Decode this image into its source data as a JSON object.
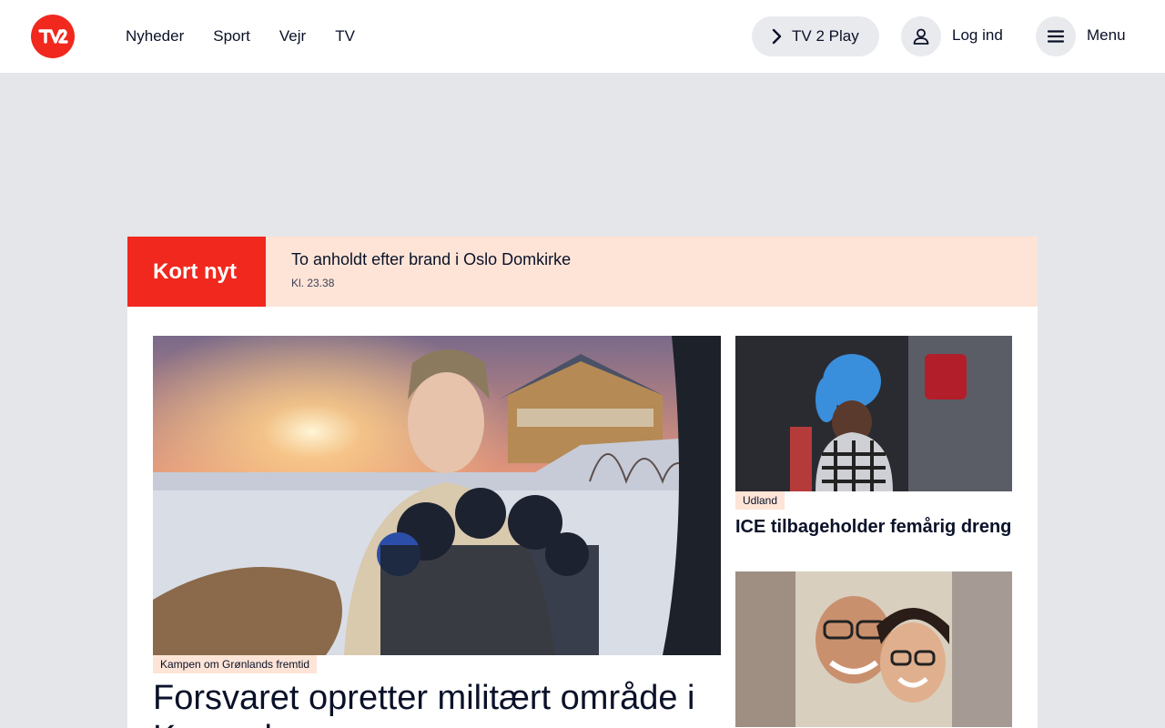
{
  "header": {
    "logo_icon": "tv2-logo",
    "nav": [
      "Nyheder",
      "Sport",
      "Vejr",
      "TV"
    ],
    "play_label": "TV 2 Play",
    "login_label": "Log ind",
    "menu_label": "Menu"
  },
  "kort_nyt": {
    "label": "Kort nyt",
    "headline": "To anholdt efter brand i Oslo Domkirke",
    "time": "Kl. 23.38"
  },
  "lead_story": {
    "tag": "Kampen om Grønlands fremtid",
    "title": "Forsvaret opretter militært område i Kangerlussuaq"
  },
  "side_stories": [
    {
      "tag": "Udland",
      "title": "ICE tilbageholder femårig dreng"
    }
  ],
  "colors": {
    "brand_red": "#f0281e",
    "tag_bg": "#fde4d7",
    "page_bg": "#e5e6ea"
  }
}
